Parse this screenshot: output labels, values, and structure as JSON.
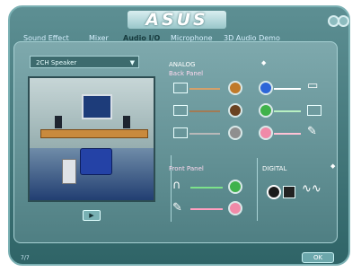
{
  "brand": "ASUS",
  "tabs": [
    {
      "label": "Sound Effect"
    },
    {
      "label": "Mixer"
    },
    {
      "label": "Audio I/O"
    },
    {
      "label": "Microphone"
    },
    {
      "label": "3D Audio Demo"
    }
  ],
  "active_tab": "Audio I/O",
  "speaker_config": {
    "selected": "2CH Speaker"
  },
  "analog": {
    "title": "ANALOG",
    "back_panel": "Back Panel",
    "front_panel": "Front Panel"
  },
  "digital": {
    "title": "DIGITAL"
  },
  "footer": {
    "status": "7/7",
    "ok_label": "OK"
  },
  "colors": {
    "jack_orange": "#c07a2a",
    "jack_blue": "#2d66d8",
    "jack_brown": "#6a4322",
    "jack_green": "#3fb24b",
    "jack_gray": "#8f8f8f",
    "jack_pink": "#f08aa8",
    "frame": "#3f7b7f"
  }
}
